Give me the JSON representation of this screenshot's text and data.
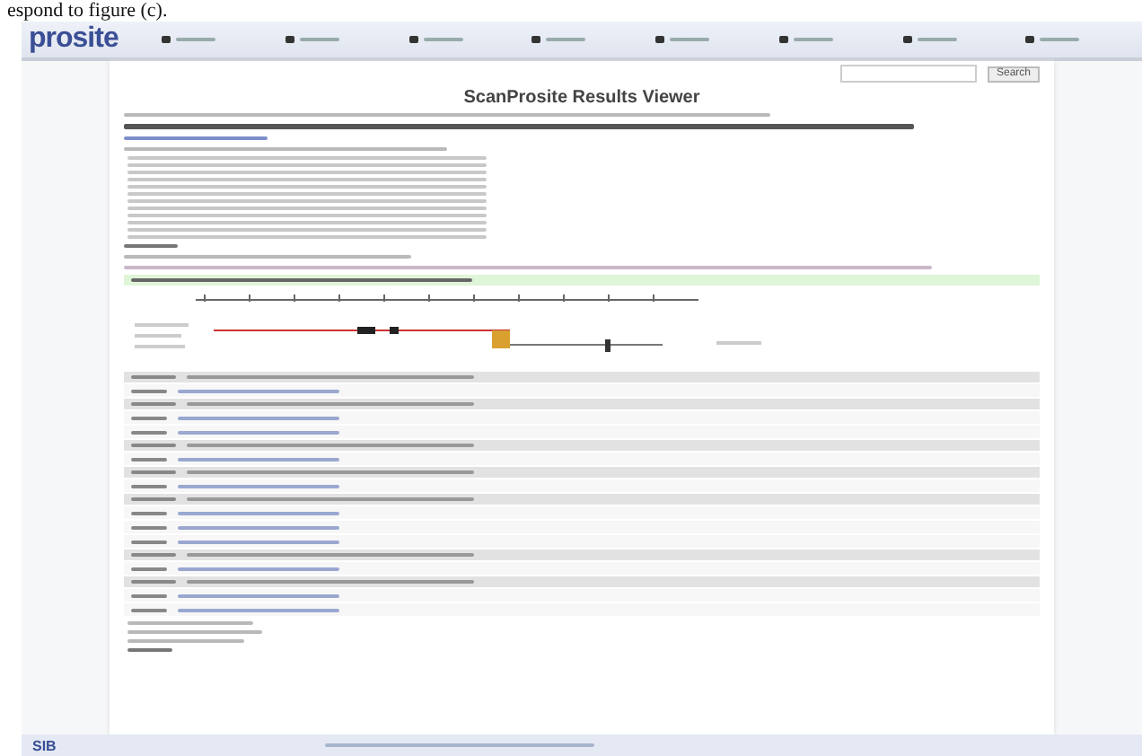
{
  "caption_fragment": "espond to figure (c).",
  "header": {
    "logo": "prosite",
    "nav_items": [
      {
        "kind": "menu"
      },
      {
        "kind": "menu"
      },
      {
        "kind": "menu"
      },
      {
        "kind": "menu"
      },
      {
        "kind": "menu"
      },
      {
        "kind": "menu"
      },
      {
        "kind": "menu"
      },
      {
        "kind": "menu"
      }
    ]
  },
  "search": {
    "button": "Search"
  },
  "title": "ScanProsite Results Viewer",
  "results": [
    {
      "kind": "header"
    },
    {
      "kind": "hit"
    },
    {
      "kind": "header"
    },
    {
      "kind": "hit"
    },
    {
      "kind": "hit"
    },
    {
      "kind": "header"
    },
    {
      "kind": "hit"
    },
    {
      "kind": "header"
    },
    {
      "kind": "hit"
    },
    {
      "kind": "header"
    },
    {
      "kind": "hit"
    },
    {
      "kind": "hit"
    },
    {
      "kind": "hit"
    },
    {
      "kind": "header"
    },
    {
      "kind": "hit"
    },
    {
      "kind": "header"
    },
    {
      "kind": "hit"
    },
    {
      "kind": "hit"
    }
  ],
  "footer": {
    "logo": "SIB"
  }
}
